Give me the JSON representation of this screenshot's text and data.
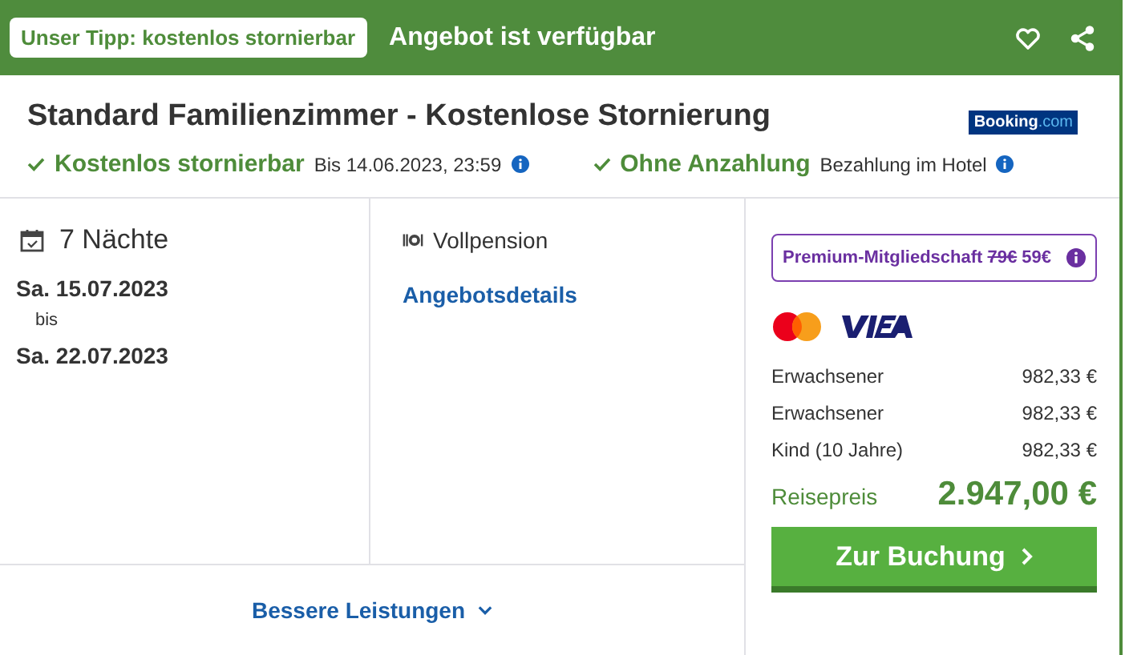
{
  "header": {
    "tip_badge": "Unser Tipp: kostenlos stornierbar",
    "status": "Angebot ist verfügbar"
  },
  "offer": {
    "title": "Standard Familienzimmer - Kostenlose Stornierung",
    "provider_logo": {
      "name": "Booking",
      "suffix": ".com"
    },
    "features": [
      {
        "label": "Kostenlos stornierbar",
        "detail": "Bis 14.06.2023, 23:59"
      },
      {
        "label": "Ohne Anzahlung",
        "detail": "Bezahlung im Hotel"
      }
    ]
  },
  "stay": {
    "nights": "7 Nächte",
    "from": "Sa. 15.07.2023",
    "between": "bis",
    "to": "Sa. 22.07.2023"
  },
  "board": {
    "meal": "Vollpension",
    "details_link": "Angebotsdetails"
  },
  "more_link": "Bessere Leistungen",
  "pricing": {
    "premium": {
      "label": "Premium-Mitgliedschaft",
      "old_price": "79€",
      "price": "59€"
    },
    "lines": [
      {
        "label": "Erwachsener",
        "amount": "982,33 €"
      },
      {
        "label": "Erwachsener",
        "amount": "982,33 €"
      },
      {
        "label": "Kind (10 Jahre)",
        "amount": "982,33 €"
      }
    ],
    "total_label": "Reisepreis",
    "total": "2.947,00 €",
    "book_button": "Zur Buchung"
  }
}
